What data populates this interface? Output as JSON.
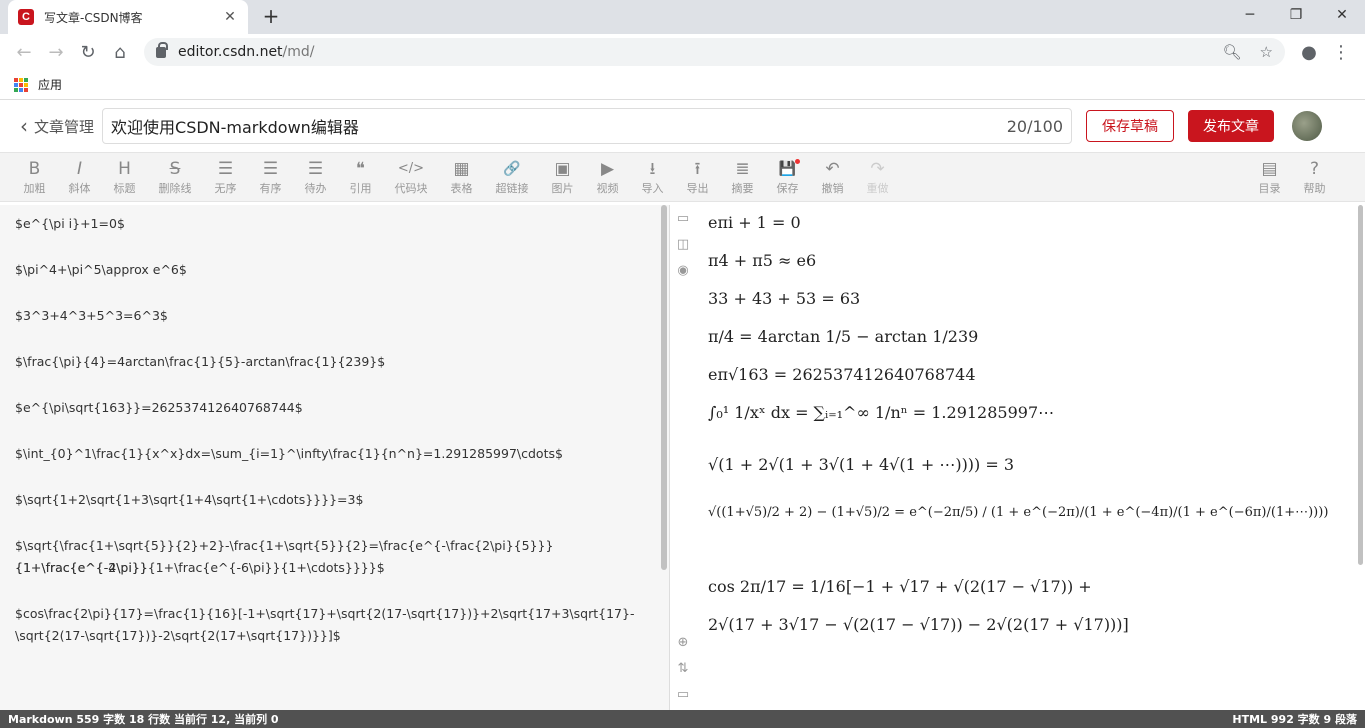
{
  "browser": {
    "tab_title": "写文章-CSDN博客",
    "favicon": "C",
    "url_host": "editor.csdn.net",
    "url_path": "/md/",
    "bookmarks_label": "应用"
  },
  "editor": {
    "back_label": "文章管理",
    "title": "欢迎使用CSDN-markdown编辑器",
    "title_count": "20/100",
    "save_draft": "保存草稿",
    "publish": "发布文章"
  },
  "toolbar": {
    "tools": [
      {
        "icon": "B",
        "label": "加粗"
      },
      {
        "icon": "I",
        "label": "斜体"
      },
      {
        "icon": "H",
        "label": "标题"
      },
      {
        "icon": "S",
        "label": "删除线"
      },
      {
        "icon": "☰",
        "label": "无序"
      },
      {
        "icon": "☰",
        "label": "有序"
      },
      {
        "icon": "☰",
        "label": "待办"
      },
      {
        "icon": "❝",
        "label": "引用"
      },
      {
        "icon": "</>",
        "label": "代码块"
      },
      {
        "icon": "▦",
        "label": "表格"
      },
      {
        "icon": "🔗",
        "label": "超链接"
      },
      {
        "icon": "▣",
        "label": "图片"
      },
      {
        "icon": "▶",
        "label": "视频"
      },
      {
        "icon": "⭳",
        "label": "导入"
      },
      {
        "icon": "⭱",
        "label": "导出"
      },
      {
        "icon": "≣",
        "label": "摘要"
      },
      {
        "icon": "💾",
        "label": "保存"
      },
      {
        "icon": "↶",
        "label": "撤销"
      },
      {
        "icon": "↷",
        "label": "重做"
      }
    ],
    "right_tools": [
      {
        "icon": "▤",
        "label": "目录"
      },
      {
        "icon": "?",
        "label": "帮助"
      }
    ]
  },
  "source_lines": [
    "$e^{\\pi i}+1=0$",
    "$\\pi^4+\\pi^5\\approx e^6$",
    "$3^3+4^3+5^3=6^3$",
    "$\\frac{\\pi}{4}=4arctan\\frac{1}{5}-arctan\\frac{1}{239}$",
    "$e^{\\pi\\sqrt{163}}=262537412640768744$",
    "$\\int_{0}^1\\frac{1}{x^x}dx=\\sum_{i=1}^\\infty\\frac{1}{n^n}=1.291285997\\cdots$",
    "$\\sqrt{1+2\\sqrt{1+3\\sqrt{1+4\\sqrt{1+\\cdots}}}}=3$",
    "$\\sqrt{\\frac{1+\\sqrt{5}}{2}+2}-\\frac{1+\\sqrt{5}}{2}=\\frac{e^{-\\frac{2\\pi}{5}}}{1+\\frac{e^{-2\\pi}}",
    "{1+\\frac{e^{-4\\pi}}{1+\\frac{e^{-6\\pi}}{1+\\cdots}}}}$",
    "$cos\\frac{2\\pi}{17}=\\frac{1}{16}[-1+\\sqrt{17}+\\sqrt{2(17-\\sqrt{17})}+2\\sqrt{17+3\\sqrt{17}-",
    "\\sqrt{2(17-\\sqrt{17})}-2\\sqrt{2(17+\\sqrt{17})}}]$"
  ],
  "preview": {
    "eq1": "eπi + 1 = 0",
    "eq2": "π4 + π5 ≈ e6",
    "eq3": "33 + 43 + 53 = 63",
    "eq4": "π/4 = 4arctan 1/5 − arctan 1/239",
    "eq5": "eπ√163 = 262537412640768744",
    "eq6": "∫₀¹ 1/xˣ dx = ∑ᵢ₌₁^∞ 1/nⁿ = 1.291285997⋯",
    "eq7": "√(1 + 2√(1 + 3√(1 + 4√(1 + ⋯)))) = 3",
    "eq8": "√((1+√5)/2 + 2) − (1+√5)/2 = e^(−2π/5) / (1 + e^(−2π)/(1 + e^(−4π)/(1 + e^(−6π)/(1+⋯))))",
    "eq9a": "cos 2π/17 = 1/16[−1 + √17 + √(2(17 − √17)) +",
    "eq9b": "2√(17 + 3√17 − √(2(17 − √17)) − 2√(2(17 + √17)))]"
  },
  "status": {
    "left": "Markdown  559 字数  18 行数  当前行 12, 当前列 0",
    "right": "HTML  992 字数  9 段落"
  }
}
